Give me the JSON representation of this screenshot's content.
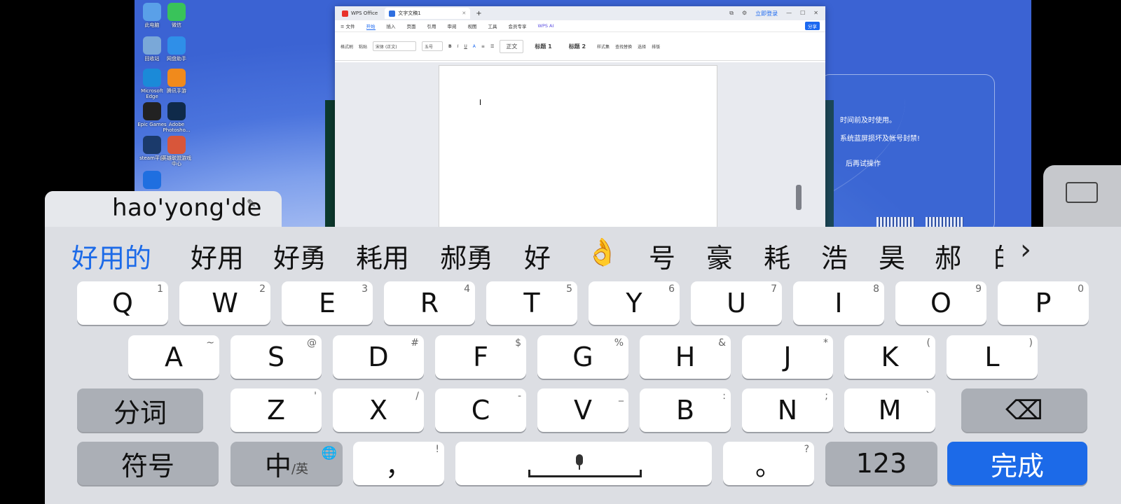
{
  "desktop": {
    "icons": [
      {
        "name": "此电脑",
        "color": "#5aa0e8"
      },
      {
        "name": "微信",
        "color": "#39c35a"
      },
      {
        "name": "回收站",
        "color": "#7aa8d8"
      },
      {
        "name": "网盘助手",
        "color": "#2f8fe8"
      },
      {
        "name": "Microsoft Edge",
        "color": "#1b8ad8"
      },
      {
        "name": "腾讯手游",
        "color": "#f08a1c"
      },
      {
        "name": "Epic Games",
        "color": "#222222"
      },
      {
        "name": "Adobe Photosho...",
        "color": "#0f2a4a"
      },
      {
        "name": "steam平台",
        "color": "#1b3a6b"
      },
      {
        "name": "英雄联盟游戏中心",
        "color": "#d8563a"
      },
      {
        "name": "",
        "color": "#1f6fe0"
      }
    ]
  },
  "wps": {
    "tabs": [
      "WPS Office",
      "文字文稿1"
    ],
    "window_controls": [
      "⧉",
      "⚙",
      "立即登录",
      "—",
      "☐",
      "✕"
    ],
    "menu": [
      "≡ 文件",
      "开始",
      "插入",
      "页面",
      "引用",
      "审阅",
      "视图",
      "工具",
      "会员专享",
      "WPS AI",
      "分享"
    ],
    "active_menu": "开始",
    "ribbon": {
      "format_painter": "格式刷",
      "paste": "粘贴",
      "font": "宋体 (正文)",
      "size": "五号",
      "styles": [
        "正文",
        "标题 1",
        "标题 2"
      ],
      "style_set": "样式集",
      "find": "查找替换",
      "select": "选择",
      "layout": "排版"
    }
  },
  "dialog": {
    "lines": [
      "时间前及时使用。",
      "系统蓝屏损坏及帐号封禁!",
      "后再试操作"
    ]
  },
  "ime": {
    "pinyin": "hao'yong'de",
    "candidates": [
      "好用的",
      "好用",
      "好勇",
      "耗用",
      "郝勇",
      "好",
      "👌",
      "号",
      "豪",
      "耗",
      "浩",
      "昊",
      "郝",
      "的"
    ],
    "more": "›",
    "rows": [
      [
        {
          "k": "Q",
          "s": "1"
        },
        {
          "k": "W",
          "s": "2"
        },
        {
          "k": "E",
          "s": "3"
        },
        {
          "k": "R",
          "s": "4"
        },
        {
          "k": "T",
          "s": "5"
        },
        {
          "k": "Y",
          "s": "6"
        },
        {
          "k": "U",
          "s": "7"
        },
        {
          "k": "I",
          "s": "8"
        },
        {
          "k": "O",
          "s": "9"
        },
        {
          "k": "P",
          "s": "0"
        }
      ],
      [
        {
          "k": "A",
          "s": "~"
        },
        {
          "k": "S",
          "s": "@"
        },
        {
          "k": "D",
          "s": "#"
        },
        {
          "k": "F",
          "s": "$"
        },
        {
          "k": "G",
          "s": "%"
        },
        {
          "k": "H",
          "s": "&"
        },
        {
          "k": "J",
          "s": "*"
        },
        {
          "k": "K",
          "s": "("
        },
        {
          "k": "L",
          "s": ")"
        }
      ],
      [
        {
          "k": "Z",
          "s": "'"
        },
        {
          "k": "X",
          "s": "/"
        },
        {
          "k": "C",
          "s": "-"
        },
        {
          "k": "V",
          "s": "_"
        },
        {
          "k": "B",
          "s": ":"
        },
        {
          "k": "N",
          "s": ";"
        },
        {
          "k": "M",
          "s": "`"
        }
      ]
    ],
    "segment": "分词",
    "backspace": "⌫",
    "symbols": "符号",
    "lang_main": "中",
    "lang_sub": "/英",
    "globe": "🌐",
    "comma": "，",
    "comma_sub": "!",
    "period": "。",
    "period_sub": "?",
    "num": "123",
    "done": "完成"
  }
}
